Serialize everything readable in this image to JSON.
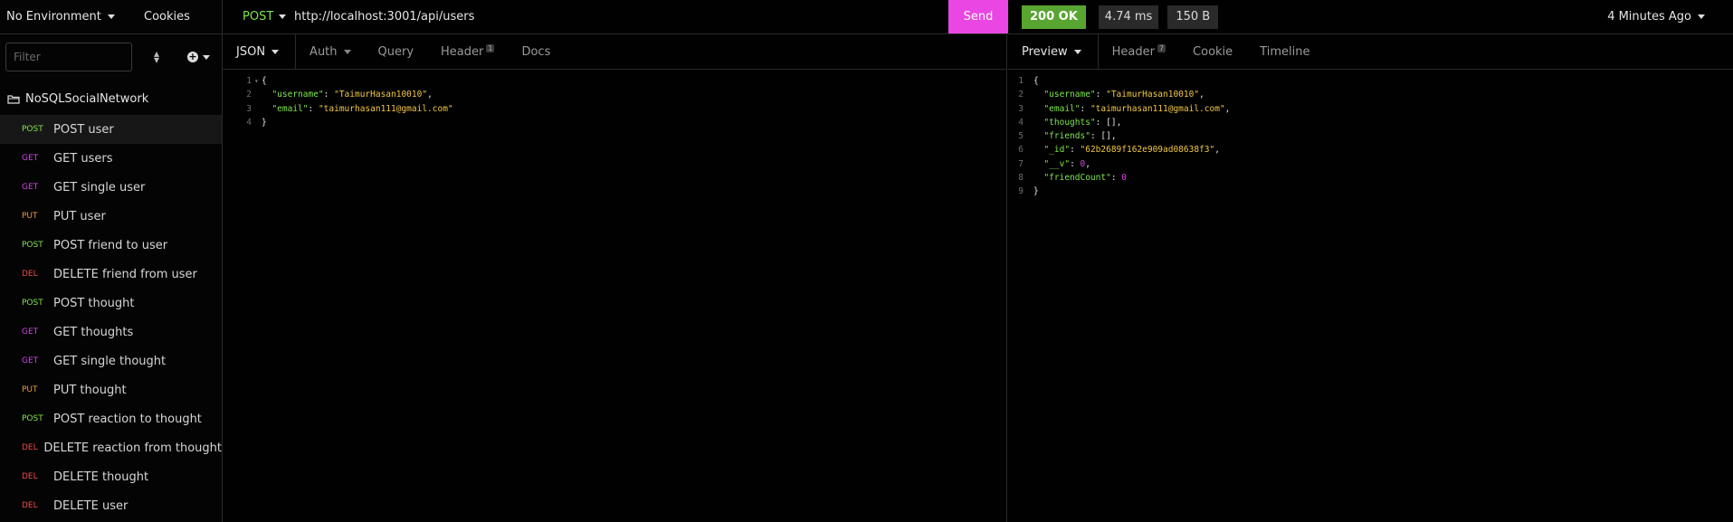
{
  "sidebar": {
    "environment": "No Environment",
    "cookies": "Cookies",
    "filter_placeholder": "Filter",
    "collection": "NoSQLSocialNetwork",
    "requests": [
      {
        "method": "POST",
        "name": "POST user"
      },
      {
        "method": "GET",
        "name": "GET users"
      },
      {
        "method": "GET",
        "name": "GET single user"
      },
      {
        "method": "PUT",
        "name": "PUT user"
      },
      {
        "method": "POST",
        "name": "POST friend to user"
      },
      {
        "method": "DEL",
        "name": "DELETE friend from user"
      },
      {
        "method": "POST",
        "name": "POST thought"
      },
      {
        "method": "GET",
        "name": "GET thoughts"
      },
      {
        "method": "GET",
        "name": "GET single thought"
      },
      {
        "method": "PUT",
        "name": "PUT thought"
      },
      {
        "method": "POST",
        "name": "POST reaction to thought"
      },
      {
        "method": "DEL",
        "name": "DELETE reaction from thought"
      },
      {
        "method": "DEL",
        "name": "DELETE thought"
      },
      {
        "method": "DEL",
        "name": "DELETE user"
      }
    ]
  },
  "request": {
    "method": "POST",
    "url": "http://localhost:3001/api/users",
    "send": "Send",
    "tabs": {
      "json": "JSON",
      "auth": "Auth",
      "query": "Query",
      "header": "Header",
      "header_count": "1",
      "docs": "Docs"
    },
    "body": [
      {
        "n": "1",
        "text": "{"
      },
      {
        "n": "2",
        "key": "\"username\"",
        "val": "\"TaimurHasan10010\"",
        "end": ","
      },
      {
        "n": "3",
        "key": "\"email\"",
        "val": "\"taimurhasan111@gmail.com\"",
        "end": ""
      },
      {
        "n": "4",
        "text": "}"
      }
    ]
  },
  "response": {
    "status": "200 OK",
    "time": "4.74 ms",
    "size": "150 B",
    "ago": "4 Minutes Ago",
    "tabs": {
      "preview": "Preview",
      "header": "Header",
      "header_count": "7",
      "cookie": "Cookie",
      "timeline": "Timeline"
    },
    "body": [
      {
        "n": "1",
        "text": "{"
      },
      {
        "n": "2",
        "key": "\"username\"",
        "val": "\"TaimurHasan10010\"",
        "type": "s",
        "end": ","
      },
      {
        "n": "3",
        "key": "\"email\"",
        "val": "\"taimurhasan111@gmail.com\"",
        "type": "s",
        "end": ","
      },
      {
        "n": "4",
        "key": "\"thoughts\"",
        "val": "[]",
        "type": "p",
        "end": ","
      },
      {
        "n": "5",
        "key": "\"friends\"",
        "val": "[]",
        "type": "p",
        "end": ","
      },
      {
        "n": "6",
        "key": "\"_id\"",
        "val": "\"62b2689f162e909ad08638f3\"",
        "type": "s",
        "end": ","
      },
      {
        "n": "7",
        "key": "\"__v\"",
        "val": "0",
        "type": "n",
        "end": ","
      },
      {
        "n": "8",
        "key": "\"friendCount\"",
        "val": "0",
        "type": "n",
        "end": ""
      },
      {
        "n": "9",
        "text": "}"
      }
    ]
  },
  "colors": {
    "send": "#e946e3",
    "status_ok": "#59a532",
    "post": "#7fe54d",
    "get": "#cf46e6",
    "put": "#ee9a3a",
    "delete": "#ef4a4a"
  }
}
